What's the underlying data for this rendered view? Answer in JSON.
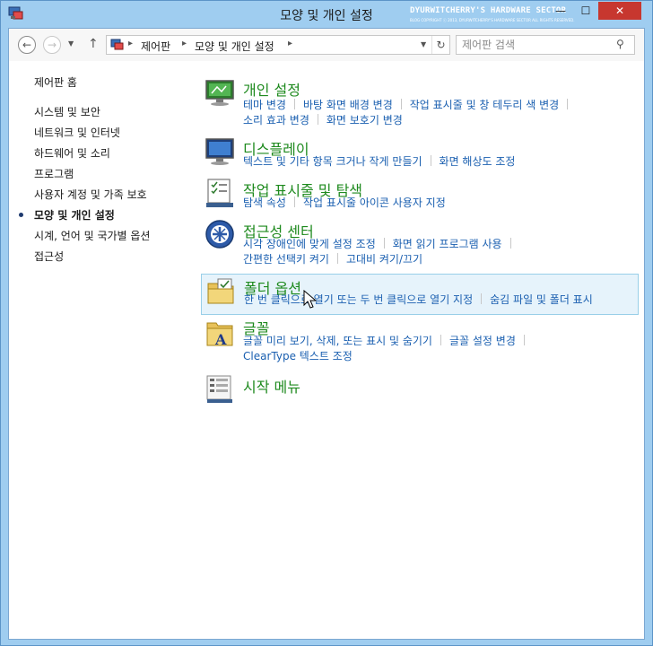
{
  "window": {
    "title": "모양 및 개인 설정",
    "watermark": "DYURWITCHERRY'S HARDWARE SECTOR",
    "watermark_sub": "BLOG COPYRIGHT ⓒ 2013, DYURWITCHERRY'S HARDWARE SECTOR ALL RIGHTS RESERVED.",
    "close_label": "✕",
    "minimize_label": "—",
    "maximize_label": "☐"
  },
  "nav": {
    "back_label": "←",
    "forward_label": "→",
    "dropdown_label": "▼",
    "up_label": "↑",
    "refresh_label": "↻"
  },
  "address": {
    "crumbs": [
      "제어판",
      "모양 및 개인 설정"
    ],
    "separator": "▸"
  },
  "search": {
    "placeholder": "제어판 검색",
    "icon_glyph": "⚲"
  },
  "sidebar": {
    "home": "제어판 홈",
    "items": [
      {
        "label": "시스템 및 보안"
      },
      {
        "label": "네트워크 및 인터넷"
      },
      {
        "label": "하드웨어 및 소리"
      },
      {
        "label": "프로그램"
      },
      {
        "label": "사용자 계정 및 가족 보호"
      },
      {
        "label": "모양 및 개인 설정",
        "current": true
      },
      {
        "label": "시계, 언어 및 국가별 옵션"
      },
      {
        "label": "접근성"
      }
    ]
  },
  "categories": [
    {
      "title": "개인 설정",
      "icon": "personalization-icon",
      "links": [
        [
          "테마 변경",
          "바탕 화면 배경 변경",
          "작업 표시줄 및 창 테두리 색 변경"
        ],
        [
          "소리 효과 변경",
          "화면 보호기 변경"
        ]
      ]
    },
    {
      "title": "디스플레이",
      "icon": "display-icon",
      "links": [
        [
          "텍스트 및 기타 항목 크거나 작게 만들기",
          "화면 해상도 조정"
        ]
      ]
    },
    {
      "title": "작업 표시줄 및 탐색",
      "icon": "taskbar-icon",
      "links": [
        [
          "탐색 속성",
          "작업 표시줄 아이콘 사용자 지정"
        ]
      ]
    },
    {
      "title": "접근성 센터",
      "icon": "ease-of-access-icon",
      "links": [
        [
          "시각 장애인에 맞게 설정 조정",
          "화면 읽기 프로그램 사용"
        ],
        [
          "간편한 선택키 켜기",
          "고대비 켜기/끄기"
        ]
      ]
    },
    {
      "title": "폴더 옵션",
      "icon": "folder-options-icon",
      "hover": true,
      "links": [
        [
          "한 번 클릭으로 열기 또는 두 번 클릭으로 열기 지정",
          "숨김 파일 및 폴더 표시"
        ]
      ]
    },
    {
      "title": "글꼴",
      "icon": "fonts-icon",
      "links": [
        [
          "글꼴 미리 보기, 삭제, 또는 표시 및 숨기기",
          "글꼴 설정 변경"
        ],
        [
          "ClearType 텍스트 조정"
        ]
      ]
    },
    {
      "title": "시작 메뉴",
      "icon": "start-menu-icon",
      "links": []
    }
  ],
  "colors": {
    "titlebar": "#9fcdf0",
    "category_title": "#1e8a1e",
    "link": "#1a5fb0",
    "close_button": "#c7372f"
  }
}
